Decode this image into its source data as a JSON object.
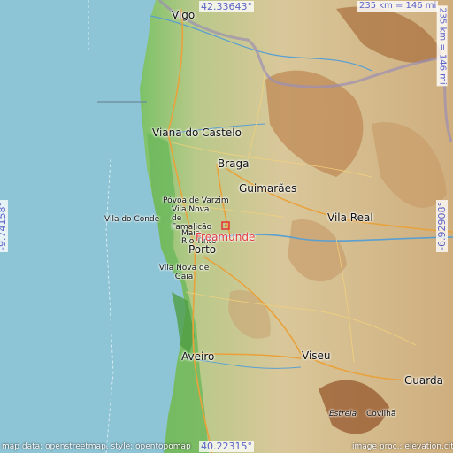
{
  "map": {
    "focus_place": "Freamunde",
    "coordinates": {
      "north": "42.33643°",
      "south": "40.22315°",
      "west": "-9.74158°",
      "east": "-6.92908°"
    },
    "scale": {
      "horizontal": "235 km = 146 mi",
      "vertical": "235 km = 146 mi"
    },
    "attribution_left": "map data: openstreetmap, style: opentopomap",
    "attribution_right": "image proc.: elevation.city",
    "places": {
      "vigo": "Vigo",
      "viana": "Viana do Castelo",
      "braga": "Braga",
      "guimaraes": "Guimarães",
      "povoa": "Póvoa de Varzim",
      "famalicao": "Vila Nova de Famalicão",
      "vila_do_conde": "Vila do Conde",
      "vila_real": "Vila Real",
      "maia": "Maia",
      "rio_tinto": "Rio Tinto",
      "porto": "Porto",
      "gaia": "Vila Nova de Gaia",
      "aveiro": "Aveiro",
      "viseu": "Viseu",
      "guarda": "Guarda",
      "estrela": "Estrela",
      "covilha": "Covilhã"
    },
    "colors": {
      "sea": "#8ec5d6",
      "lowland": "#7cc267",
      "hills": "#d9c79a",
      "mountains": "#b07a48",
      "focus": "#e33b3b",
      "coord_text": "#5b62c6"
    }
  }
}
